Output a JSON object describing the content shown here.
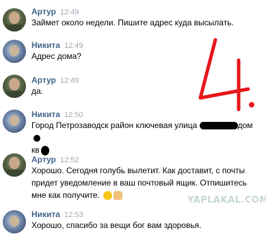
{
  "messages": [
    {
      "sender": "Артур",
      "time": "12:49",
      "text": "Займет около недели. Пишите адрес куда высылать."
    },
    {
      "sender": "Никита",
      "time": "12:49",
      "text": "Адрес дома?"
    },
    {
      "sender": "Артур",
      "time": "12:49",
      "text": "да."
    },
    {
      "sender": "Никита",
      "time": "12:50",
      "text_parts": [
        "Город Петрозаводск район ключевая улица ",
        "дом",
        "кв"
      ]
    },
    {
      "sender": "Артур",
      "time": "12:52",
      "text": "Хорошо. Сегодня голубь вылетит. Как доставит, с почты придет уведомление в ваш почтовый ящик. Отпишитесь мне как получите."
    },
    {
      "sender": "Никита",
      "time": "12:53",
      "text": "Хорошо, спасибо за вещи бог вам здоровья."
    }
  ],
  "annotation": "4.",
  "watermark": "YAPLAKAL.COM",
  "colors": {
    "name": "#42648b",
    "time": "#a0a7b1",
    "annotation": "#e8161b"
  }
}
